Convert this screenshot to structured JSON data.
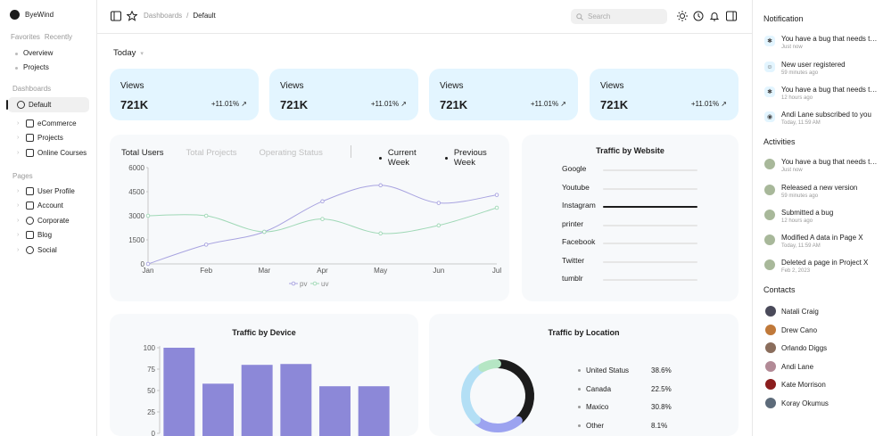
{
  "brand": {
    "name": "ByeWind"
  },
  "favorites": {
    "tabs": [
      "Favorites",
      "Recently"
    ],
    "items": [
      "Overview",
      "Projects"
    ]
  },
  "sidebar": {
    "dashboards_title": "Dashboards",
    "dashboards": [
      {
        "label": "Default",
        "icon": "pie-icon",
        "active": true
      },
      {
        "label": "eCommerce",
        "icon": "cart-icon"
      },
      {
        "label": "Projects",
        "icon": "folder-icon"
      },
      {
        "label": "Online Courses",
        "icon": "book-icon"
      }
    ],
    "pages_title": "Pages",
    "pages": [
      {
        "label": "User Profile",
        "icon": "user-profile-icon"
      },
      {
        "label": "Account",
        "icon": "account-icon"
      },
      {
        "label": "Corporate",
        "icon": "corporate-icon"
      },
      {
        "label": "Blog",
        "icon": "blog-icon"
      },
      {
        "label": "Social",
        "icon": "social-icon"
      }
    ]
  },
  "topbar": {
    "breadcrumb_root": "Dashboards",
    "breadcrumb_sep": "/",
    "breadcrumb_current": "Default",
    "search_placeholder": "Search"
  },
  "main": {
    "period": "Today",
    "stats": [
      {
        "label": "Views",
        "value": "721K",
        "change": "+11.01%"
      },
      {
        "label": "Views",
        "value": "721K",
        "change": "+11.01%"
      },
      {
        "label": "Views",
        "value": "721K",
        "change": "+11.01%"
      },
      {
        "label": "Views",
        "value": "721K",
        "change": "+11.01%"
      }
    ],
    "users_tabs": [
      "Total Users",
      "Total Projects",
      "Operating Status"
    ],
    "week_legend": [
      "Current Week",
      "Previous Week"
    ],
    "traffic_website_title": "Traffic by Website",
    "traffic_device_title": "Traffic by Device",
    "traffic_location_title": "Traffic by Location",
    "locations": [
      {
        "name": "United Status",
        "pct": "38.6%"
      },
      {
        "name": "Canada",
        "pct": "22.5%"
      },
      {
        "name": "Maxico",
        "pct": "30.8%"
      },
      {
        "name": "Other",
        "pct": "8.1%"
      }
    ]
  },
  "chart_data": [
    {
      "type": "line",
      "x": [
        "Jan",
        "Feb",
        "Mar",
        "Apr",
        "May",
        "Jun",
        "Jul"
      ],
      "series": [
        {
          "name": "pv",
          "values": [
            0,
            1200,
            2000,
            3900,
            4900,
            3800,
            4300
          ],
          "color": "#a8a3e0"
        },
        {
          "name": "uv",
          "values": [
            3000,
            3000,
            2000,
            2800,
            1900,
            2400,
            3500
          ],
          "color": "#9fd8b6"
        }
      ],
      "ylim": [
        0,
        6000
      ],
      "yticks": [
        0,
        1500,
        3000,
        4500,
        6000
      ],
      "grid": false,
      "legend": "bottom-center"
    },
    {
      "type": "bar",
      "title": "Traffic by Website",
      "categories": [
        "Google",
        "Youtube",
        "Instagram",
        "printer",
        "Facebook",
        "Twitter",
        "tumblr"
      ],
      "values": [
        0,
        0,
        1,
        0,
        0,
        0,
        0
      ]
    },
    {
      "type": "bar",
      "title": "Traffic by Device",
      "categories": [
        "",
        "",
        "",
        "",
        "",
        ""
      ],
      "values": [
        100,
        58,
        80,
        81,
        55,
        55
      ],
      "ylim": [
        0,
        100
      ],
      "yticks": [
        0,
        25,
        50,
        75,
        100
      ],
      "color": "#8c88d8"
    },
    {
      "type": "pie",
      "title": "Traffic by Location",
      "categories": [
        "United Status",
        "Canada",
        "Maxico",
        "Other"
      ],
      "values": [
        38.6,
        22.5,
        30.8,
        8.1
      ],
      "colors": [
        "#1c1c1c",
        "#9ca3f0",
        "#b3dff5",
        "#b5e6c4"
      ]
    }
  ],
  "right_panel": {
    "notification_title": "Notification",
    "notifications": [
      {
        "text": "You have a bug that needs to be fixed",
        "time": "Just now",
        "icon": "bug-icon"
      },
      {
        "text": "New user registered",
        "time": "59 minutes ago",
        "icon": "user-icon"
      },
      {
        "text": "You have a bug that needs to be fixed",
        "time": "12 hours ago",
        "icon": "bug-icon"
      },
      {
        "text": "Andi Lane subscribed to you",
        "time": "Today, 11:59 AM",
        "icon": "broadcast-icon"
      }
    ],
    "activities_title": "Activities",
    "activities": [
      {
        "text": "You have a bug that needs to be fixed",
        "time": "Just now"
      },
      {
        "text": "Released a new version",
        "time": "59 minutes ago"
      },
      {
        "text": "Submitted a bug",
        "time": "12 hours ago"
      },
      {
        "text": "Modified A data in Page X",
        "time": "Today, 11:59 AM"
      },
      {
        "text": "Deleted a page in Project X",
        "time": "Feb 2, 2023"
      }
    ],
    "contacts_title": "Contacts",
    "contacts": [
      {
        "name": "Natali Craig",
        "color": "#4a4a5a"
      },
      {
        "name": "Drew Cano",
        "color": "#c0793a"
      },
      {
        "name": "Orlando Diggs",
        "color": "#8a6d5c"
      },
      {
        "name": "Andi Lane",
        "color": "#b28a96"
      },
      {
        "name": "Kate Morrison",
        "color": "#8b1e1e"
      },
      {
        "name": "Koray Okumus",
        "color": "#5d6b7a"
      }
    ]
  }
}
